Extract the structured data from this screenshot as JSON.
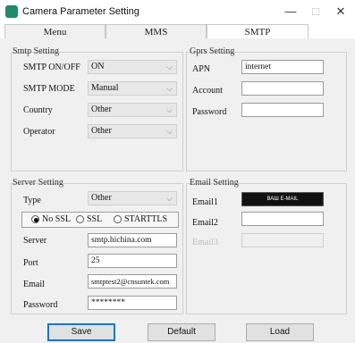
{
  "window": {
    "title": "Camera Parameter Setting",
    "minimize": "—",
    "maximize": "□",
    "close": "✕"
  },
  "tabs": [
    {
      "label": "Menu",
      "active": false
    },
    {
      "label": "MMS",
      "active": false
    },
    {
      "label": "SMTP",
      "active": true
    }
  ],
  "smtp_setting": {
    "title": "Smtp Setting",
    "on_off_label": "SMTP ON/OFF",
    "on_off_value": "ON",
    "mode_label": "SMTP MODE",
    "mode_value": "Manual",
    "country_label": "Country",
    "country_value": "Other",
    "operator_label": "Operator",
    "operator_value": "Other"
  },
  "gprs_setting": {
    "title": "Gprs Setting",
    "apn_label": "APN",
    "apn_value": "internet",
    "account_label": "Account",
    "account_value": "",
    "password_label": "Password",
    "password_value": ""
  },
  "server_setting": {
    "title": "Server Setting",
    "type_label": "Type",
    "type_value": "Other",
    "ssl_options": [
      "No SSL",
      "SSL",
      "STARTTLS"
    ],
    "ssl_selected": "No SSL",
    "server_label": "Server",
    "server_value": "smtp.hichina.com",
    "port_label": "Port",
    "port_value": "25",
    "email_label": "Email",
    "email_value": "smtptest2@cnsuntek.com",
    "password_label": "Password",
    "password_value": "********"
  },
  "email_setting": {
    "title": "Email Setting",
    "email1_label": "Email1",
    "email1_value": "ВАШ E-MAIL",
    "email2_label": "Email2",
    "email2_value": "",
    "email3_label": "Email3",
    "email3_value": ""
  },
  "buttons": {
    "save": "Save",
    "default": "Default",
    "load": "Load"
  },
  "colors": {
    "app_icon": "#1f8a6a",
    "primary_button_border": "#0078d7",
    "panel_background": "#f0f0f0"
  }
}
